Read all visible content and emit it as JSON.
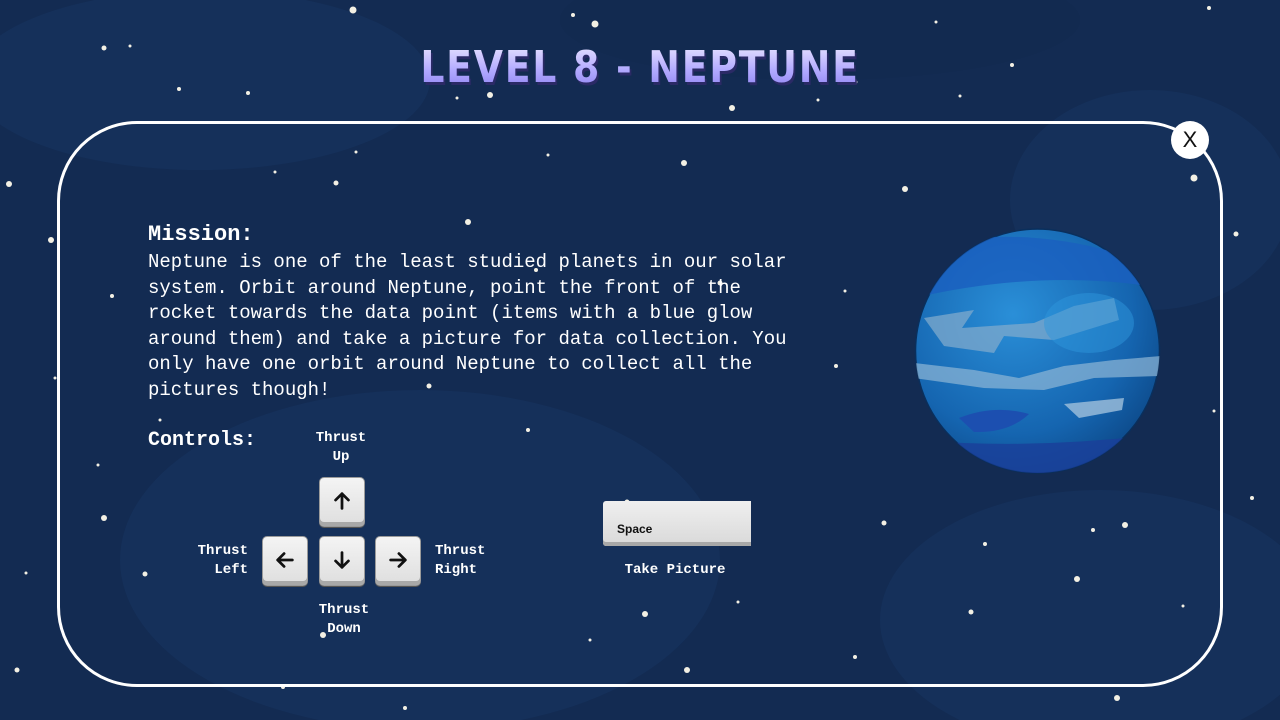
{
  "title": "LEVEL 8 - NEPTUNE",
  "close_label": "X",
  "mission": {
    "heading": "Mission:",
    "text": "Neptune is one of the least studied planets in our solar system. Orbit around Neptune, point the front of the rocket towards the data point (items with a blue glow around them) and take a picture for data collection. You only have one orbit around Neptune to collect all the pictures though!"
  },
  "controls": {
    "heading": "Controls:",
    "thrust_up": "Thrust Up",
    "thrust_down": "Thrust Down",
    "thrust_left": "Thrust Left",
    "thrust_right": "Thrust Right",
    "space_key": "Space",
    "take_picture": "Take Picture"
  },
  "icons": {
    "up": "arrow-up-icon",
    "down": "arrow-down-icon",
    "left": "arrow-left-icon",
    "right": "arrow-right-icon"
  },
  "colors": {
    "background": "#132b52",
    "panel_border": "#ffffff",
    "planet": "#1673c2",
    "title": "#b2aaff"
  }
}
